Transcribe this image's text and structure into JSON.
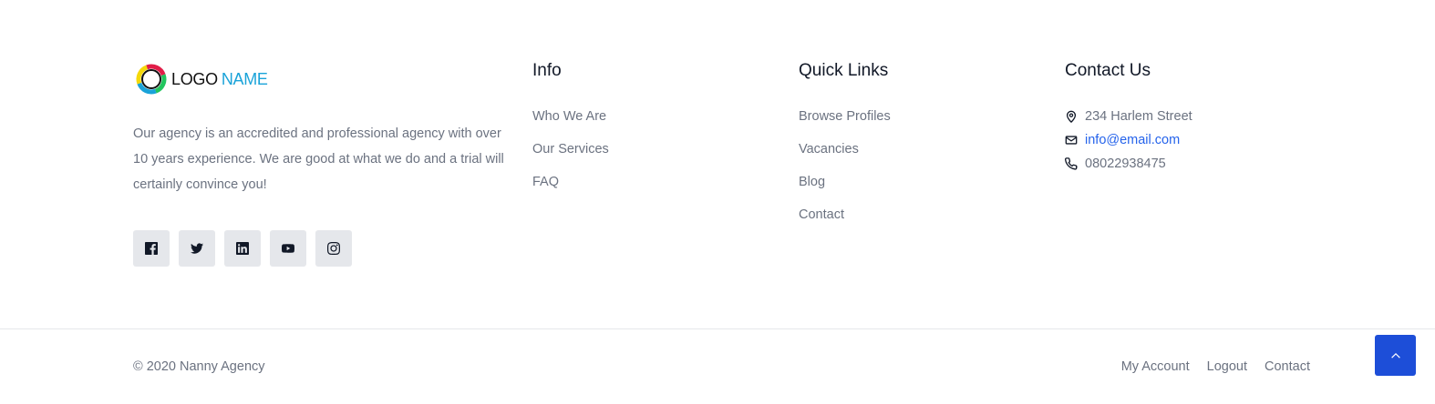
{
  "brand": {
    "logo_word1": "LOGO",
    "logo_word2": "NAME",
    "logo_colors": [
      "#f5d90a",
      "#e11d48",
      "#22c55e",
      "#1aa3d9",
      "#111111"
    ],
    "about": "Our agency is an accredited and professional agency with over 10 years experience. We are good at what we do and a trial will certainly convince you!",
    "socials": [
      {
        "name": "facebook",
        "icon": "facebook-icon"
      },
      {
        "name": "twitter",
        "icon": "twitter-icon"
      },
      {
        "name": "linkedin",
        "icon": "linkedin-icon"
      },
      {
        "name": "youtube",
        "icon": "youtube-icon"
      },
      {
        "name": "instagram",
        "icon": "instagram-icon"
      }
    ]
  },
  "info": {
    "title": "Info",
    "links": [
      "Who We Are",
      "Our Services",
      "FAQ"
    ]
  },
  "quick_links": {
    "title": "Quick Links",
    "links": [
      "Browse Profiles",
      "Vacancies",
      "Blog",
      "Contact"
    ]
  },
  "contact": {
    "title": "Contact Us",
    "address": "234 Harlem Street",
    "email": "info@email.com",
    "phone": "08022938475"
  },
  "bottom": {
    "copyright": "© 2020 Nanny Agency",
    "links": [
      "My Account",
      "Logout",
      "Contact"
    ]
  },
  "colors": {
    "accent": "#1d4ed8",
    "link_blue": "#2563eb",
    "social_bg": "#e5e7eb"
  }
}
